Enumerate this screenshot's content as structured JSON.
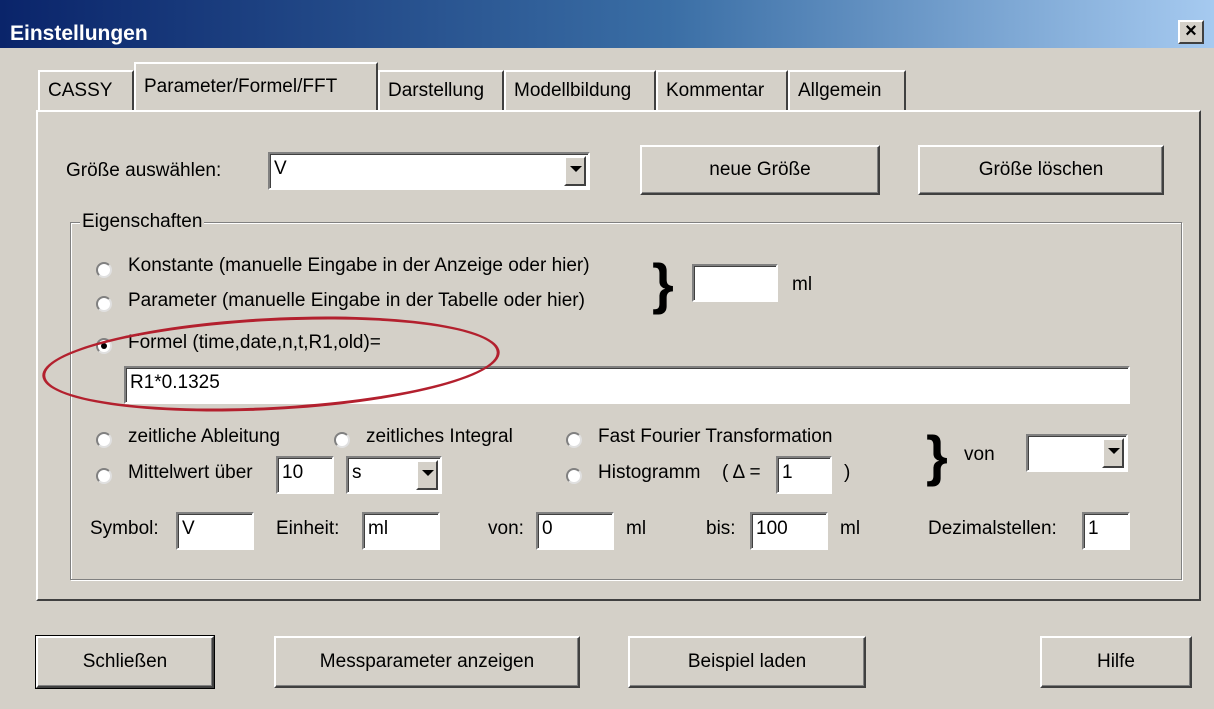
{
  "window": {
    "title": "Einstellungen",
    "close_label": "×"
  },
  "tabs": [
    {
      "label": "CASSY"
    },
    {
      "label": "Parameter/Formel/FFT"
    },
    {
      "label": "Darstellung"
    },
    {
      "label": "Modellbildung"
    },
    {
      "label": "Kommentar"
    },
    {
      "label": "Allgemein"
    }
  ],
  "groesse": {
    "label": "Größe auswählen:",
    "selected": "V",
    "new_button": "neue Größe",
    "delete_button": "Größe löschen"
  },
  "eigenschaften": {
    "group_label": "Eigenschaften",
    "konstante_label": "Konstante (manuelle Eingabe in der Anzeige oder hier)",
    "parameter_label": "Parameter (manuelle Eingabe in der Tabelle oder hier)",
    "value": "",
    "unit": "ml",
    "formel_label": "Formel (time,date,n,t,R1,old)=",
    "formel_value": "R1*0.1325",
    "ableitung_label": "zeitliche Ableitung",
    "integral_label": "zeitliches Integral",
    "fft_label": "Fast Fourier Transformation",
    "mittelwert_label": "Mittelwert über",
    "mittelwert_value": "10",
    "mittelwert_unit": "s",
    "histogramm_label": "Histogramm",
    "histogramm_delta_prefix": "( Δ =",
    "histogramm_delta_value": "1",
    "histogramm_delta_suffix": ")",
    "von_label": "von",
    "von_select": "",
    "symbol_label": "Symbol:",
    "symbol_value": "V",
    "einheit_label": "Einheit:",
    "einheit_value": "ml",
    "von2_label": "von:",
    "von2_value": "0",
    "von2_unit": "ml",
    "bis_label": "bis:",
    "bis_value": "100",
    "bis_unit": "ml",
    "dezimal_label": "Dezimalstellen:",
    "dezimal_value": "1"
  },
  "footer": {
    "close_button": "Schließen",
    "mess_button": "Messparameter anzeigen",
    "beispiel_button": "Beispiel laden",
    "hilfe_button": "Hilfe"
  },
  "colors": {
    "title_start": "#0a246a",
    "title_end": "#a6caf0",
    "highlight_ellipse": "#b3202e"
  }
}
